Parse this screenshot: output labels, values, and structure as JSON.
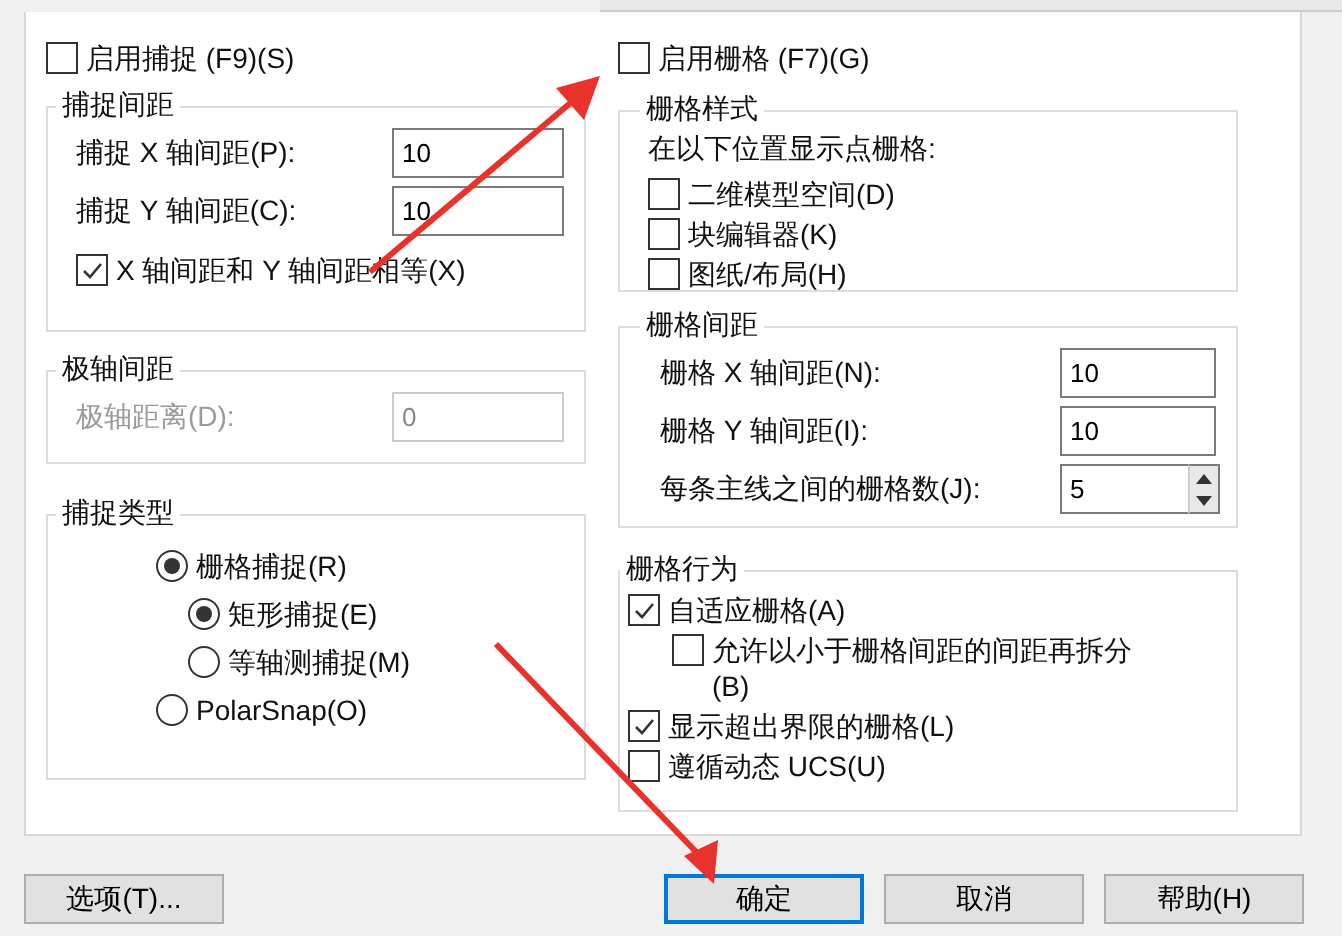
{
  "snap_enable": {
    "label": "启用捕捉 (F9)(S)",
    "checked": false
  },
  "snap_spacing": {
    "title": "捕捉间距",
    "fields": [
      {
        "label": "捕捉 X 轴间距(P):",
        "value": "10"
      },
      {
        "label": "捕捉 Y 轴间距(C):",
        "value": "10"
      }
    ],
    "equal_checkbox": {
      "label": "X 轴间距和 Y 轴间距相等(X)",
      "checked": true
    }
  },
  "polar_spacing": {
    "title": "极轴间距",
    "field": {
      "label": "极轴距离(D):",
      "value": "0",
      "disabled": true
    }
  },
  "snap_type": {
    "title": "捕捉类型",
    "options": [
      {
        "label": "栅格捕捉(R)",
        "selected": true,
        "children": [
          {
            "label": "矩形捕捉(E)",
            "selected": true
          },
          {
            "label": "等轴测捕捉(M)",
            "selected": false
          }
        ]
      },
      {
        "label": "PolarSnap(O)",
        "selected": false
      }
    ]
  },
  "grid_enable": {
    "label": "启用栅格 (F7)(G)",
    "checked": false
  },
  "grid_style": {
    "title": "栅格样式",
    "caption": "在以下位置显示点栅格:",
    "checkboxes": [
      {
        "label": "二维模型空间(D)",
        "checked": false
      },
      {
        "label": "块编辑器(K)",
        "checked": false
      },
      {
        "label": "图纸/布局(H)",
        "checked": false
      }
    ]
  },
  "grid_spacing": {
    "title": "栅格间距",
    "fields": [
      {
        "label": "栅格 X 轴间距(N):",
        "value": "10",
        "kind": "text"
      },
      {
        "label": "栅格 Y 轴间距(I):",
        "value": "10",
        "kind": "text"
      },
      {
        "label": "每条主线之间的栅格数(J):",
        "value": "5",
        "kind": "spinner"
      }
    ]
  },
  "grid_behavior": {
    "title": "栅格行为",
    "checkboxes": [
      {
        "label": "自适应栅格(A)",
        "checked": true,
        "children": [
          {
            "label": "允许以小于栅格间距的间距再拆分(B)",
            "checked": false
          }
        ]
      },
      {
        "label": "显示超出界限的栅格(L)",
        "checked": true
      },
      {
        "label": "遵循动态 UCS(U)",
        "checked": false
      }
    ]
  },
  "buttons": [
    {
      "label": "选项(T)...",
      "kind": "plain"
    },
    {
      "label": "确定",
      "kind": "default"
    },
    {
      "label": "取消",
      "kind": "plain"
    },
    {
      "label": "帮助(H)",
      "kind": "plain"
    }
  ]
}
